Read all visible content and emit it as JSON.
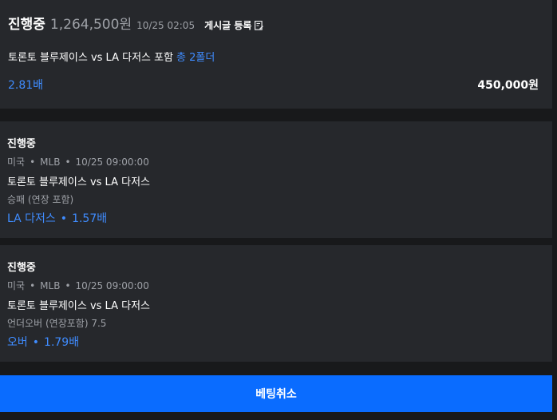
{
  "summary": {
    "status": "진행중",
    "amount": "1,264,500원",
    "datetime": "10/25 02:05",
    "post_label": "게시글 등록",
    "match_text": "토론토 블루제이스 vs LA 다저스 포함",
    "folder_text": "총 2폴더",
    "odds": "2.81배",
    "stake": "450,000원"
  },
  "picks": [
    {
      "status": "진행중",
      "country": "미국",
      "league": "MLB",
      "time": "10/25 09:00:00",
      "match": "토론토 블루제이스 vs LA 다저스",
      "market": "승패 (연장 포함)",
      "selection": "LA 다저스",
      "odds": "1.57배"
    },
    {
      "status": "진행중",
      "country": "미국",
      "league": "MLB",
      "time": "10/25 09:00:00",
      "match": "토론토 블루제이스 vs LA 다저스",
      "market": "언더오버 (연장포함) 7.5",
      "selection": "오버",
      "odds": "1.79배"
    }
  ],
  "cancel_label": "베팅취소",
  "separator": "•",
  "colors": {
    "background": "#18191b",
    "card": "#26282c",
    "accent": "#3f8cff",
    "button": "#0a6cff",
    "muted": "#9ea1a7"
  },
  "icons": {
    "post": "edit-icon"
  }
}
